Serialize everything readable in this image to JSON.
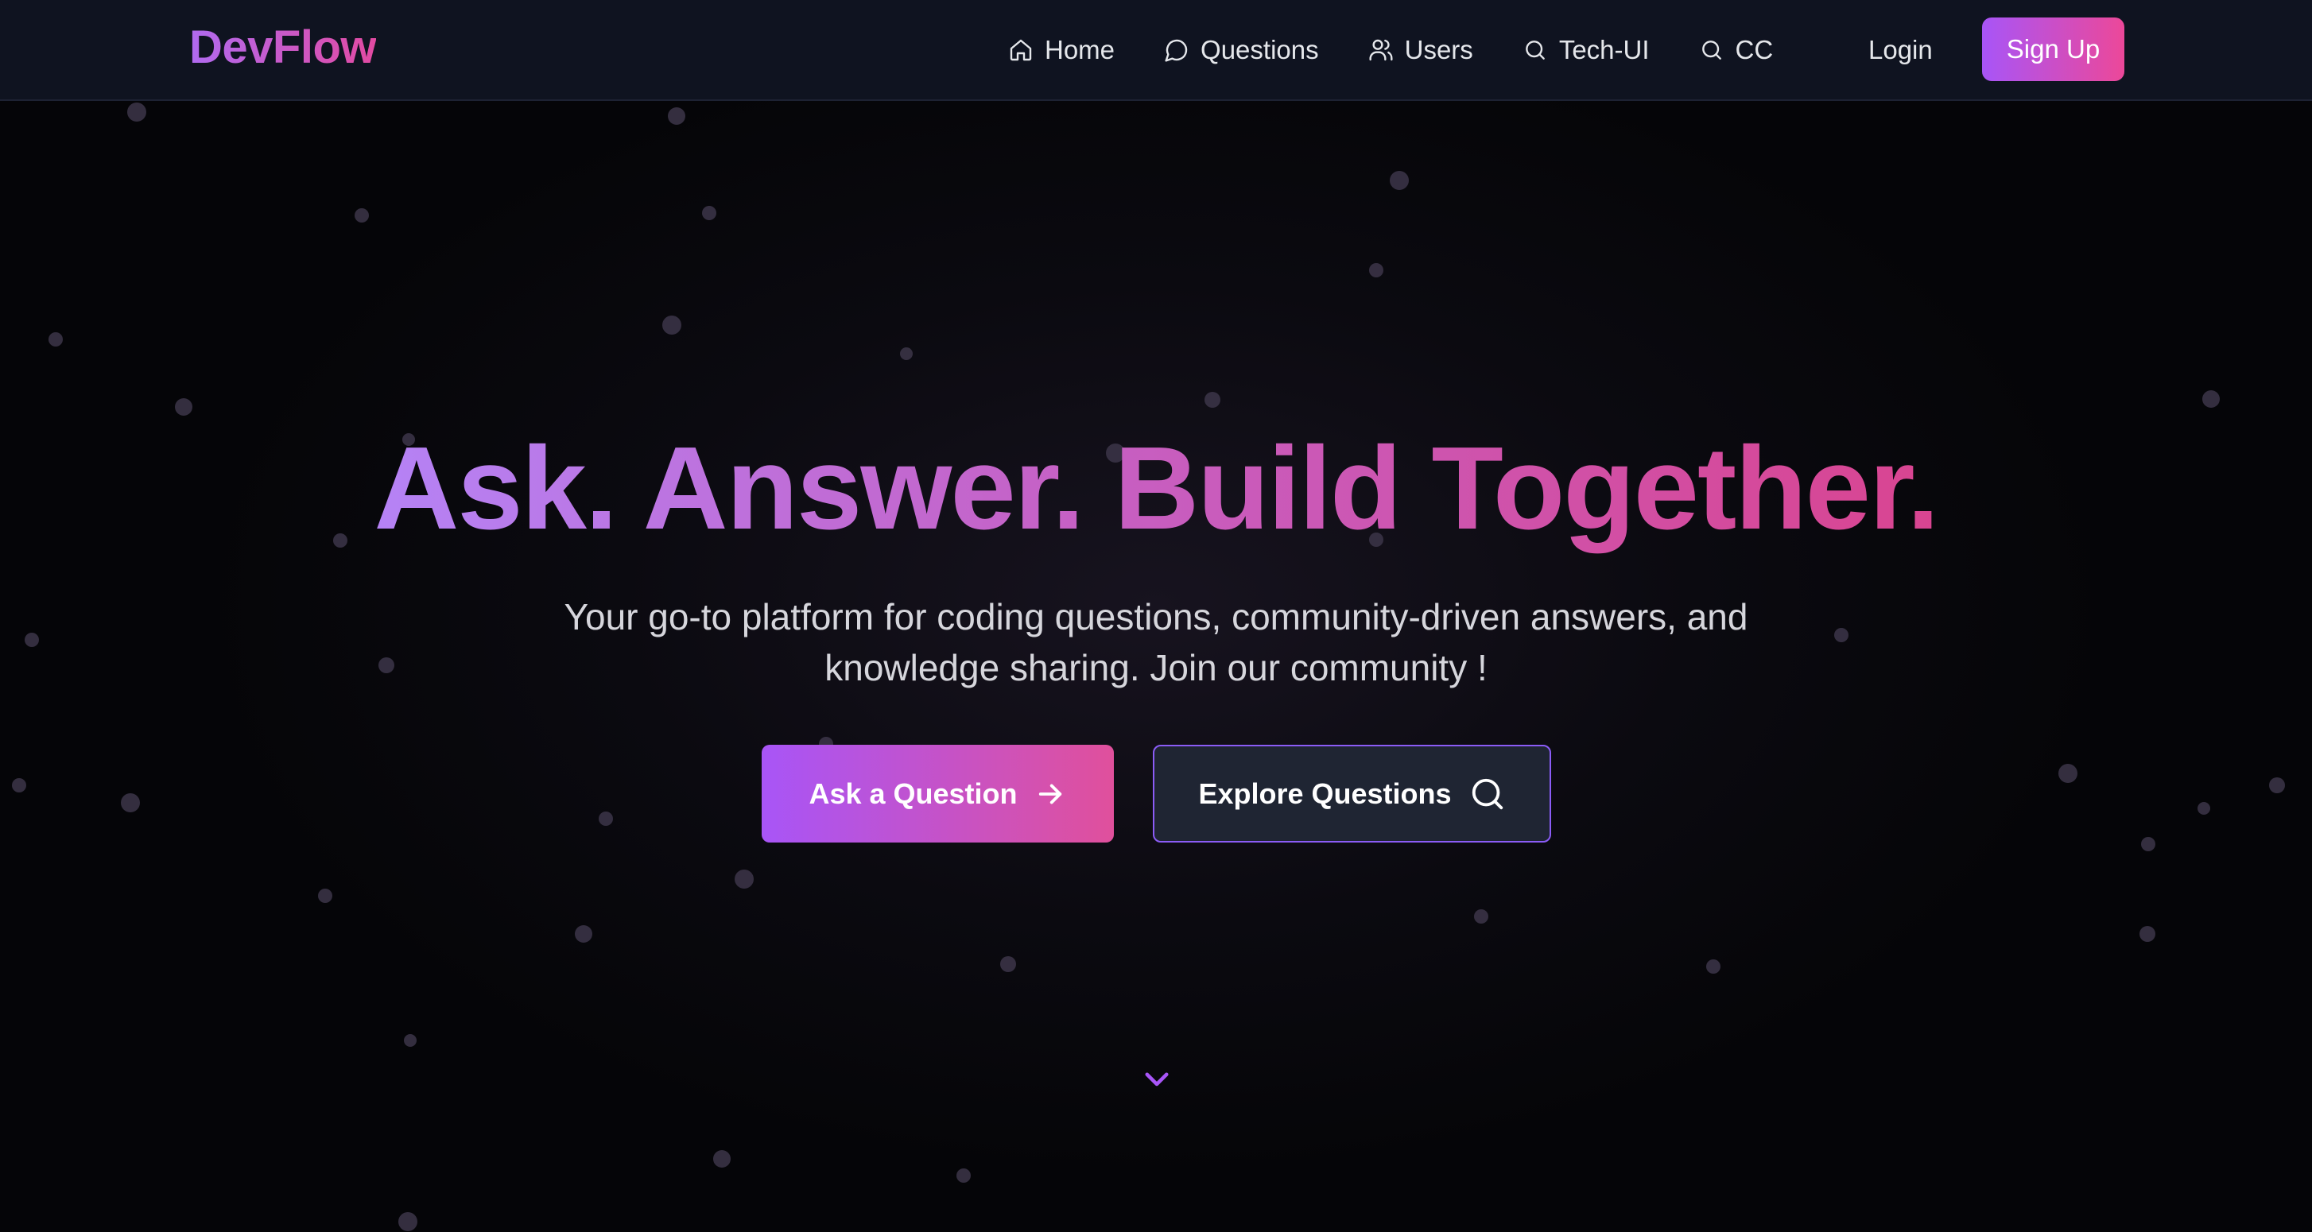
{
  "brand": {
    "logo_text": "DevFlow"
  },
  "nav": {
    "items": [
      {
        "label": "Home",
        "icon": "home-icon"
      },
      {
        "label": "Questions",
        "icon": "chat-bubble-icon"
      },
      {
        "label": "Users",
        "icon": "users-icon"
      },
      {
        "label": "Tech-UI",
        "icon": "search-icon"
      },
      {
        "label": "CC",
        "icon": "search-icon"
      }
    ],
    "login_label": "Login",
    "signup_label": "Sign Up"
  },
  "hero": {
    "title": "Ask. Answer. Build Together.",
    "subtitle": "Your go-to platform for coding questions, community-driven answers, and knowledge sharing. Join our community !",
    "primary_cta": {
      "label": "Ask a Question",
      "icon": "arrow-right-icon"
    },
    "secondary_cta": {
      "label": "Explore Questions",
      "icon": "search-icon"
    },
    "scroll_icon": "chevron-down-icon"
  },
  "colors": {
    "background": "#050508",
    "navbar": "#0f1320",
    "accent_purple": "#a855f7",
    "accent_pink": "#ec4899",
    "particle": "#3a3346"
  }
}
